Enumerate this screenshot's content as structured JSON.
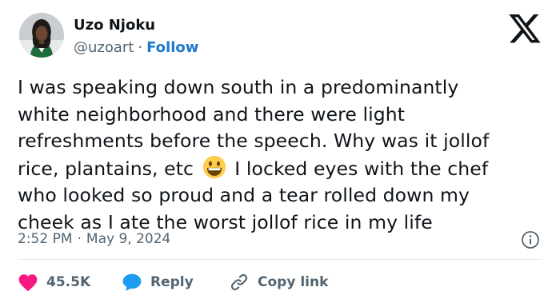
{
  "author": {
    "display_name": "Uzo Njoku",
    "handle": "@uzoart",
    "separator": "·",
    "follow_label": "Follow"
  },
  "brand_icon": "x-logo-icon",
  "tweet": {
    "lines": [
      "I was speaking down south in a predominantly",
      "white neighborhood and there were light",
      "refreshments before the speech. Why was it jollof",
      "rice, plantains, etc",
      "I locked eyes with the chef",
      "who looked so proud and a tear rolled down my",
      "cheek as I ate the worst jollof rice in my life"
    ],
    "emoji": "grinning-face-emoji"
  },
  "meta": {
    "time": "2:52 PM",
    "separator": "·",
    "date": "May 9, 2024",
    "info_icon": "info-icon"
  },
  "actions": {
    "like_count": "45.5K",
    "reply_label": "Reply",
    "copy_link_label": "Copy link"
  },
  "colors": {
    "text": "#0f1419",
    "secondary": "#536471",
    "follow": "#1d77cd",
    "like": "#f91880",
    "reply": "#1d9bf0",
    "divider": "#e3e8ec"
  }
}
